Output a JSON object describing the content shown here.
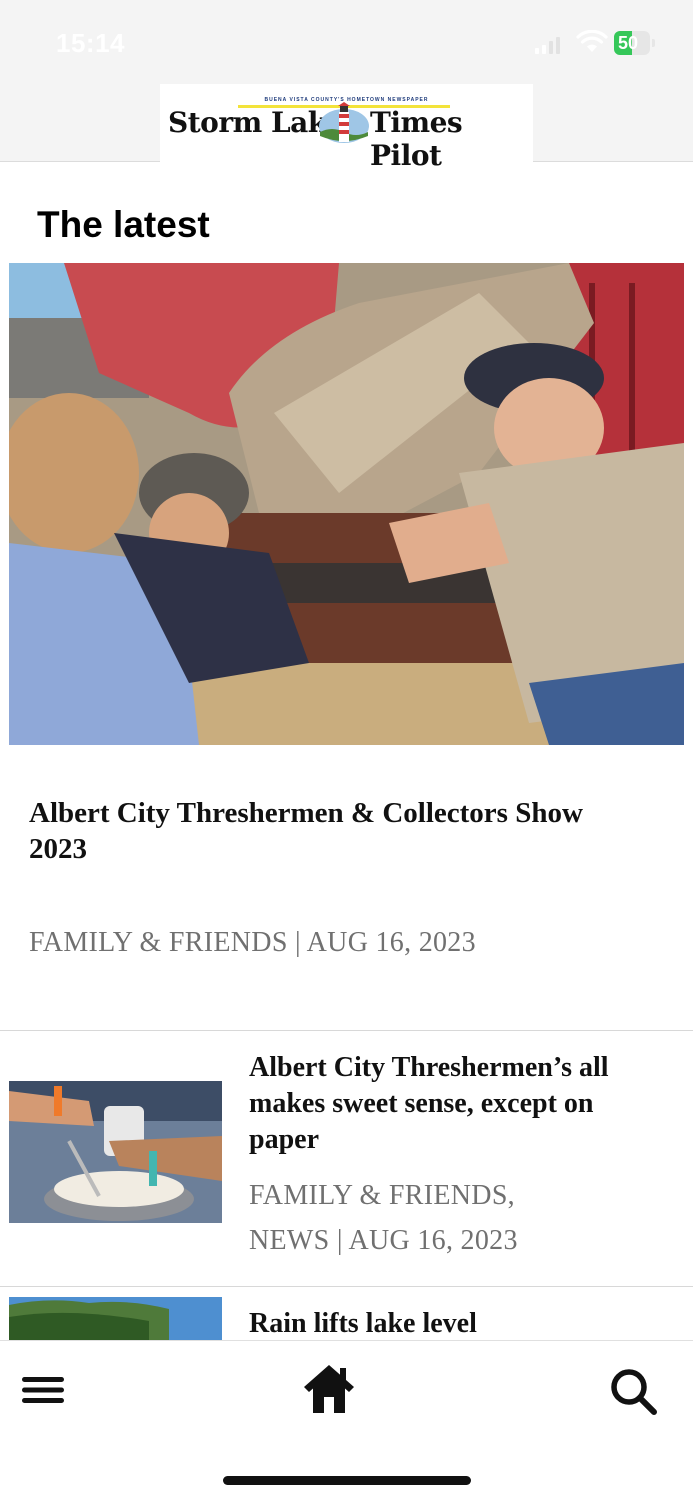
{
  "status_bar": {
    "time": "15:14",
    "battery_level": "50",
    "battery_fraction": 0.5,
    "icons": [
      "signal-icon",
      "wifi-icon",
      "battery-icon"
    ]
  },
  "masthead": {
    "tagline": "BUENA VISTA COUNTY'S HOMETOWN NEWSPAPER",
    "name_left": "Storm Lake",
    "name_right": "Times Pilot",
    "logo_alt": "Storm Lake Times Pilot"
  },
  "section": {
    "title": "The latest"
  },
  "hero": {
    "headline": "Albert City Threshermen & Collectors Show 2023",
    "meta": "FAMILY & FRIENDS | AUG 16, 2023"
  },
  "articles": [
    {
      "headline": "Albert City Threshermen’s all makes sweet sense, except on paper",
      "meta_line1": "FAMILY & FRIENDS,",
      "meta_line2": "NEWS | AUG 16, 2023"
    },
    {
      "headline": "Rain lifts lake level"
    }
  ],
  "tab_bar": {
    "items": [
      "menu-icon",
      "home-icon",
      "search-icon"
    ]
  },
  "colors": {
    "header_bg": "#f4f4f4",
    "meta_gray": "#707070",
    "battery_green": "#35c759",
    "masthead_yellow": "#f3e33a"
  }
}
